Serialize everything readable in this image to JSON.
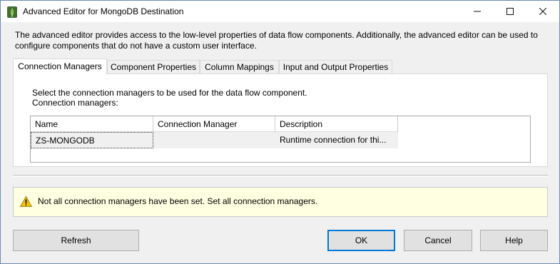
{
  "window": {
    "title": "Advanced Editor for MongoDB Destination",
    "icon": "mongodb-leaf-icon"
  },
  "description": "The advanced editor provides access to the low-level properties of data flow components. Additionally, the advanced editor can be used to configure components that do not have a custom user interface.",
  "tabs": [
    {
      "label": "Connection Managers",
      "active": true
    },
    {
      "label": "Component Properties",
      "active": false
    },
    {
      "label": "Column Mappings",
      "active": false
    },
    {
      "label": "Input and Output Properties",
      "active": false
    }
  ],
  "panel": {
    "instruction_line1": "Select the connection managers to be used for the data flow component.",
    "instruction_line2": "Connection managers:"
  },
  "grid": {
    "columns": [
      "Name",
      "Connection Manager",
      "Description"
    ],
    "rows": [
      {
        "name": "ZS-MONGODB",
        "connection_manager": "",
        "description": "Runtime connection for thi..."
      }
    ]
  },
  "warning": {
    "icon": "warning-triangle-icon",
    "text": "Not all connection managers have been set. Set all connection managers."
  },
  "buttons": {
    "refresh": "Refresh",
    "ok": "OK",
    "cancel": "Cancel",
    "help": "Help"
  },
  "colors": {
    "accent": "#0078d7",
    "warning_bg": "#ffffe1"
  }
}
